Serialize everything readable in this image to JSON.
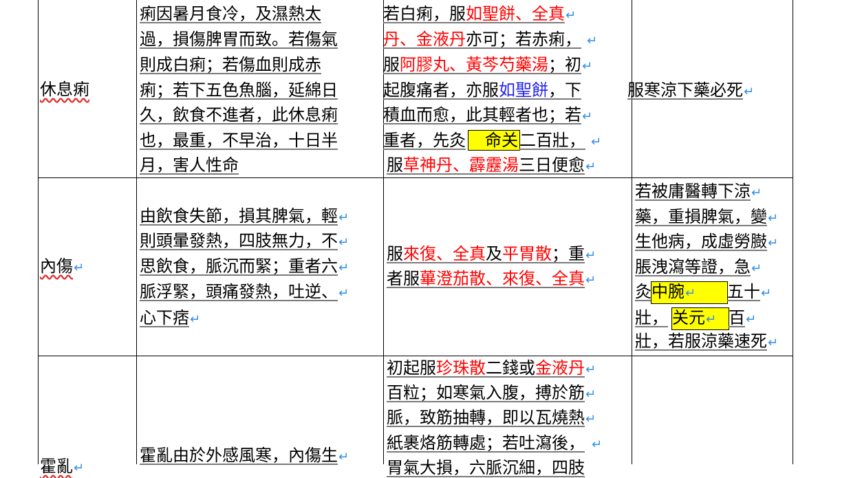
{
  "colors": {
    "drug": "#ff0000",
    "drug_alt": "#2222ee",
    "highlight": "#ffff00",
    "paragraph_mark": "#2f8ee8"
  },
  "rows": [
    {
      "name": "休息痢",
      "cause": [
        "痢因暑月食冷，及濕熱太",
        "過，損傷脾胃而致。若傷氣",
        "則成白痢；若傷血則成赤",
        "痢；若下五色魚腦，延綿日",
        "久，飲食不進者，此休息痢",
        "也，最重，不早治，十日半",
        "月，害人性命"
      ],
      "treat": {
        "l1": {
          "a": "若白痢，服",
          "d1": "如聖餅",
          "s": "、",
          "d2": "全真"
        },
        "l2": {
          "d1": "丹",
          "s1": "、",
          "d2": "金液丹",
          "t": "亦可；若赤痢，"
        },
        "l3": {
          "a": "服",
          "d1": "阿膠丸",
          "s": "、",
          "d2": "黃芩芍藥湯",
          "t": "；初"
        },
        "l4": {
          "a": "起腹痛者，亦服",
          "d1": "如聖餅",
          "t": "，下"
        },
        "l5": "積血而愈，此其輕者也；若",
        "l6": {
          "a": "重者，先灸",
          "hl": "命关",
          "t": "二百壯，"
        },
        "l7": {
          "a": "服",
          "d1": "草神丹",
          "s": "、",
          "d2": "霹靂湯",
          "t": "三日便愈"
        }
      },
      "warning": [
        "服寒涼下藥必死"
      ]
    },
    {
      "name": "內傷",
      "cause": [
        "由飲食失節，損其脾氣，輕",
        "則頭暈發熱，四肢無力，不",
        "思飲食，脈沉而緊；重者六",
        "脈浮緊，頭痛發熱，吐逆、",
        "心下痞"
      ],
      "treat": {
        "l1": {
          "a": "服",
          "d1": "來復",
          "s1": "、",
          "d2": "全真",
          "b": "及",
          "d3": "平胃散",
          "t": "；重"
        },
        "l2": {
          "a": "者服",
          "d1": "蓽澄茄散",
          "s1": "、",
          "d2": "來復",
          "s2": "、",
          "d3": "全真"
        }
      },
      "warning": {
        "l1": "若被庸醫轉下涼",
        "l2": "藥，重損脾氣，變",
        "l3": "生他病，成虛勞臌",
        "l4": "脹洩瀉等證，急",
        "l5a": "灸",
        "l5hl": "中腕",
        "l5b": "五十",
        "l6a": "壯，",
        "l6hl": "关元",
        "l6b": "百",
        "l7": "壯，若服涼藥速死"
      }
    },
    {
      "name": "霍亂",
      "cause": [
        "霍亂由於外感風寒，內傷生"
      ],
      "treat": {
        "l1": {
          "a": "初起服",
          "d1": "珍珠散",
          "b": "二錢或",
          "d2": "金液丹"
        },
        "l2": "百粒；如寒氣入腹，搏於筋",
        "l3": "脈，致筋抽轉，即以瓦燒熱",
        "l4": "紙裹烙筋轉處；若吐瀉後，",
        "l5": "胃氣大損，六脈沉細，四肢"
      }
    }
  ]
}
